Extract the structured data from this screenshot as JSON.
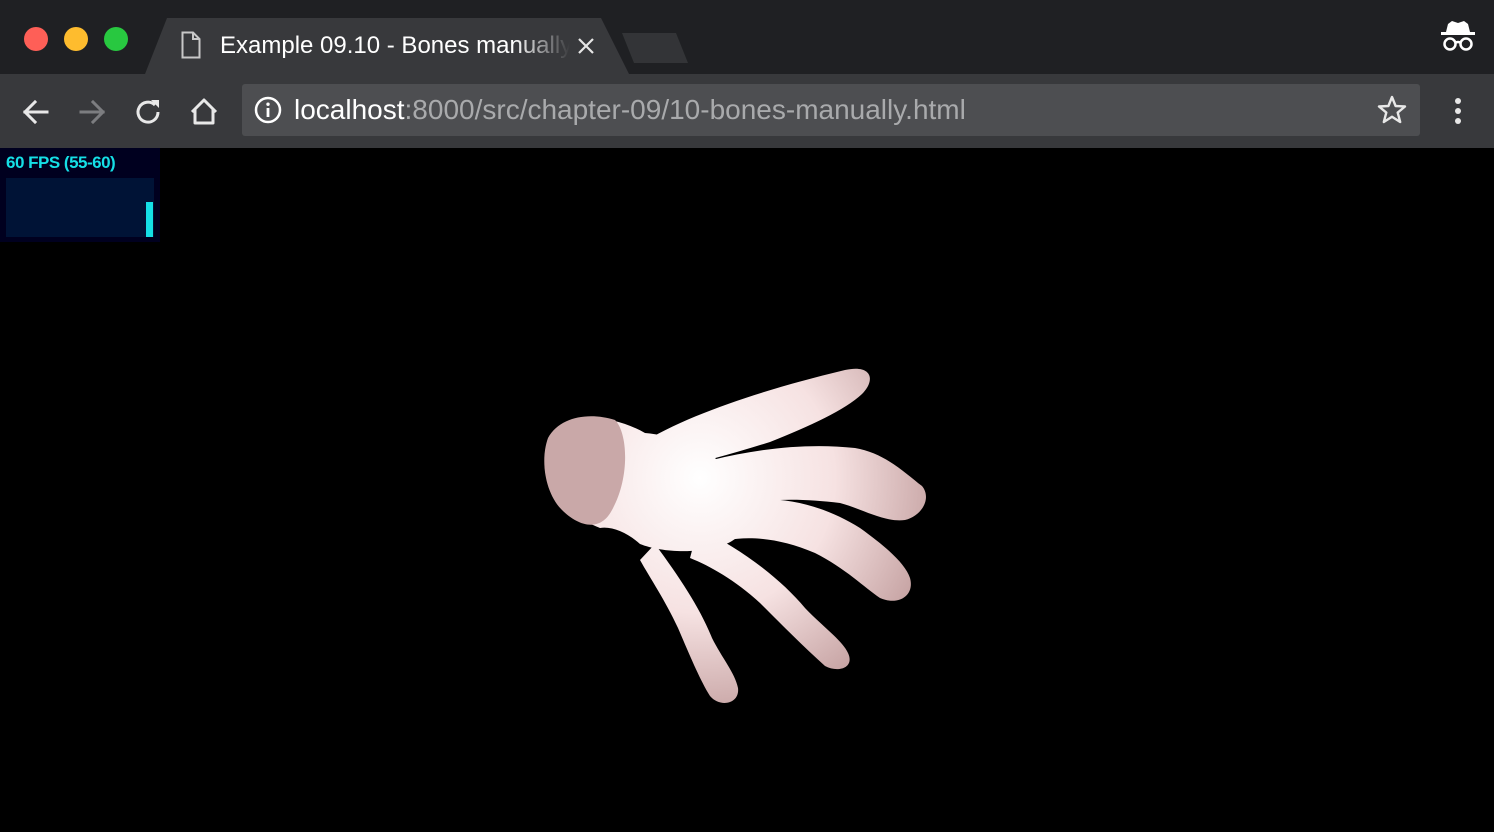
{
  "window": {
    "tab": {
      "title": "Example 09.10 - Bones manually",
      "icon": "document-icon"
    },
    "toolbar": {
      "back_icon": "arrow-left-icon",
      "forward_icon": "arrow-right-icon",
      "reload_icon": "reload-icon",
      "home_icon": "home-icon",
      "url_host": "localhost",
      "url_path": ":8000/src/chapter-09/10-bones-manually.html",
      "site_info_icon": "info-icon",
      "bookmark_icon": "star-icon",
      "menu_icon": "vertical-dots-icon",
      "incognito_icon": "incognito-icon"
    }
  },
  "page": {
    "stats": {
      "fps_text": "60 FPS (55-60)",
      "current_fps": 60,
      "min_fps": 55,
      "max_fps": 60,
      "text_color": "#15dfe6",
      "background": "#00001f"
    },
    "scene": {
      "background": "#000000",
      "object": "hand-model",
      "skin_color": "#f7e4e4"
    }
  }
}
